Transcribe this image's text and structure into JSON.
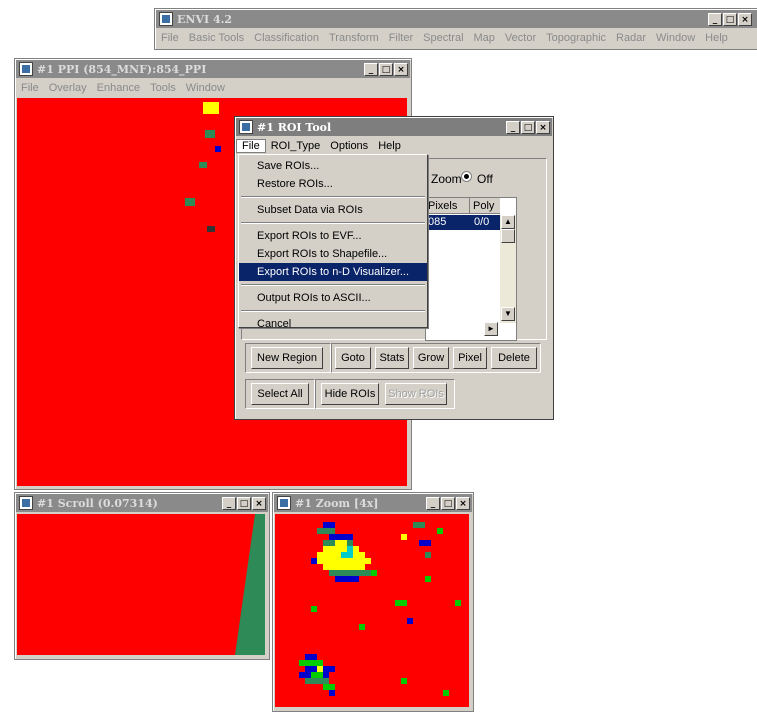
{
  "envi_main": {
    "title": "ENVI 4.2",
    "menu": [
      "File",
      "Basic Tools",
      "Classification",
      "Transform",
      "Filter",
      "Spectral",
      "Map",
      "Vector",
      "Topographic",
      "Radar",
      "Window",
      "Help"
    ]
  },
  "image_window": {
    "title": "#1 PPI (854_MNF):854_PPI",
    "menu": [
      "File",
      "Overlay",
      "Enhance",
      "Tools",
      "Window"
    ]
  },
  "roi_tool": {
    "title": "#1 ROI Tool",
    "menu": [
      "File",
      "ROI_Type",
      "Options",
      "Help"
    ],
    "zoom_label": "Zoom",
    "off_label": "Off",
    "table_headers": [
      "Pixels",
      "Poly"
    ],
    "table_row": [
      "085",
      "0/0"
    ],
    "buttons_row1": [
      "New Region",
      "Goto",
      "Stats",
      "Grow",
      "Pixel",
      "Delete"
    ],
    "buttons_row2": [
      "Select All",
      "Hide ROIs",
      "Show ROIs"
    ]
  },
  "file_menu": {
    "items": [
      "Save ROIs...",
      "Restore ROIs...",
      "Subset Data via ROIs",
      "Export ROIs to EVF...",
      "Export ROIs to Shapefile...",
      "Export ROIs to n-D Visualizer...",
      "Output ROIs to ASCII...",
      "Cancel"
    ],
    "highlighted": "Export ROIs to n-D Visualizer..."
  },
  "scroll_window": {
    "title": "#1 Scroll (0.07314)"
  },
  "zoom_window": {
    "title": "#1 Zoom [4x]"
  },
  "window_buttons": {
    "min": "_",
    "max": "□",
    "close": "×"
  },
  "colors": {
    "image_red": "#ff0000",
    "green_region": "#2e8b57",
    "highlight": "#0a246a"
  }
}
